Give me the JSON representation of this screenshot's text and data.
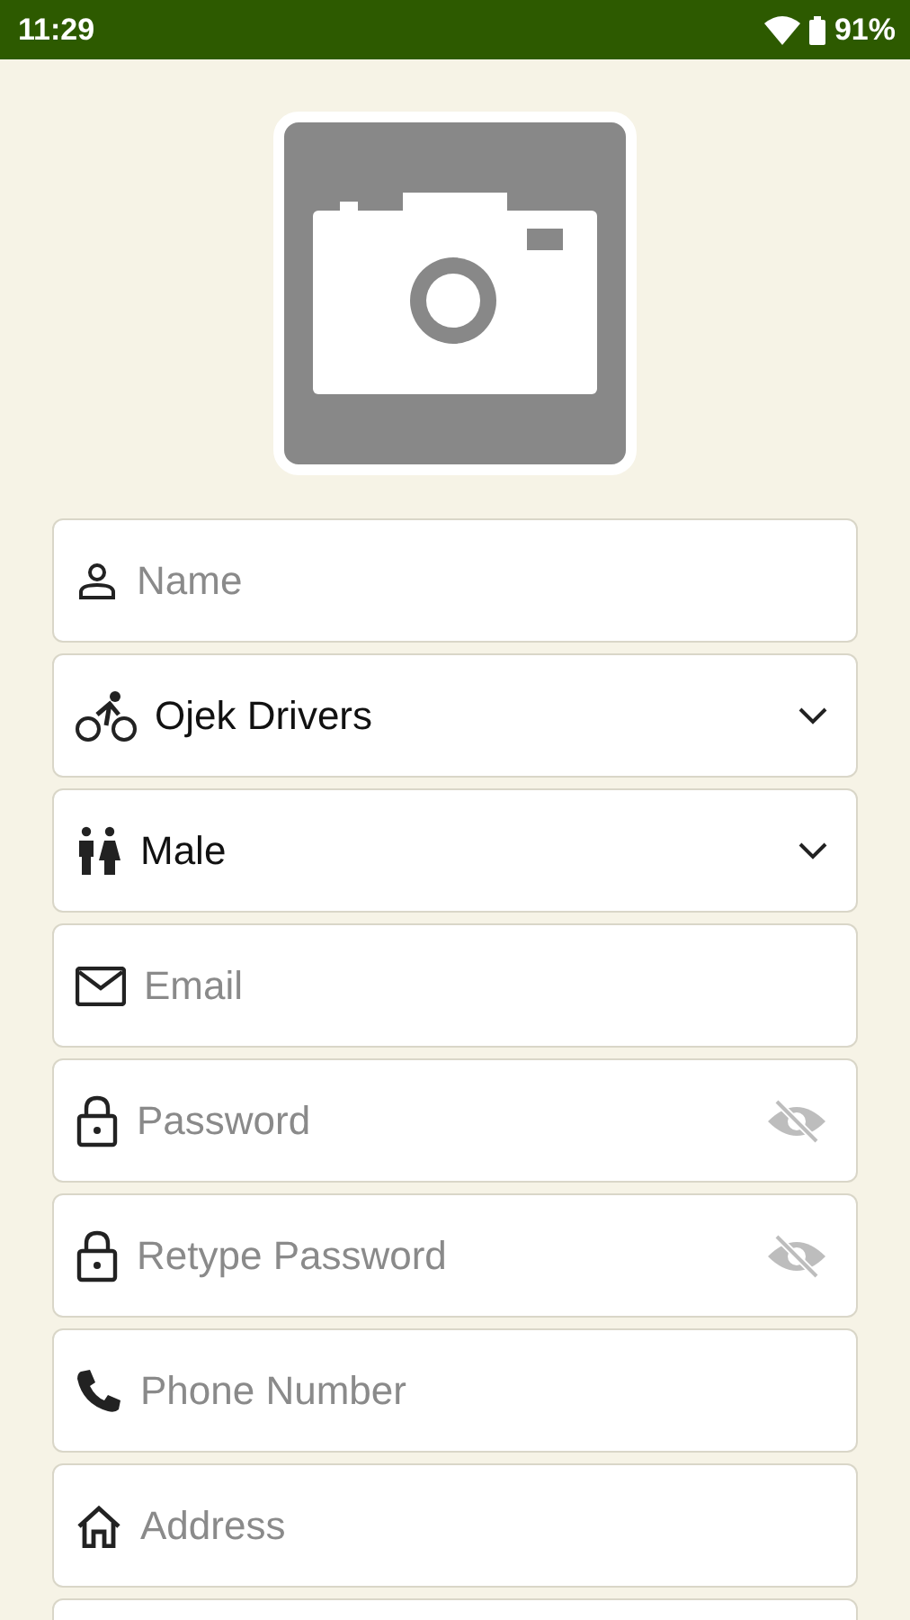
{
  "status_bar": {
    "time": "11:29",
    "battery": "91%"
  },
  "photo": {
    "kind": "camera-placeholder"
  },
  "fields": [
    {
      "kind": "text",
      "placeholder": "Name"
    },
    {
      "kind": "select",
      "value": "Ojek Drivers"
    },
    {
      "kind": "select",
      "value": "Male"
    },
    {
      "kind": "text",
      "placeholder": "Email"
    },
    {
      "kind": "password",
      "placeholder": "Password"
    },
    {
      "kind": "password",
      "placeholder": "Retype Password"
    },
    {
      "kind": "text",
      "placeholder": "Phone Number"
    },
    {
      "kind": "text",
      "placeholder": "Address"
    },
    {
      "kind": "empty"
    }
  ]
}
